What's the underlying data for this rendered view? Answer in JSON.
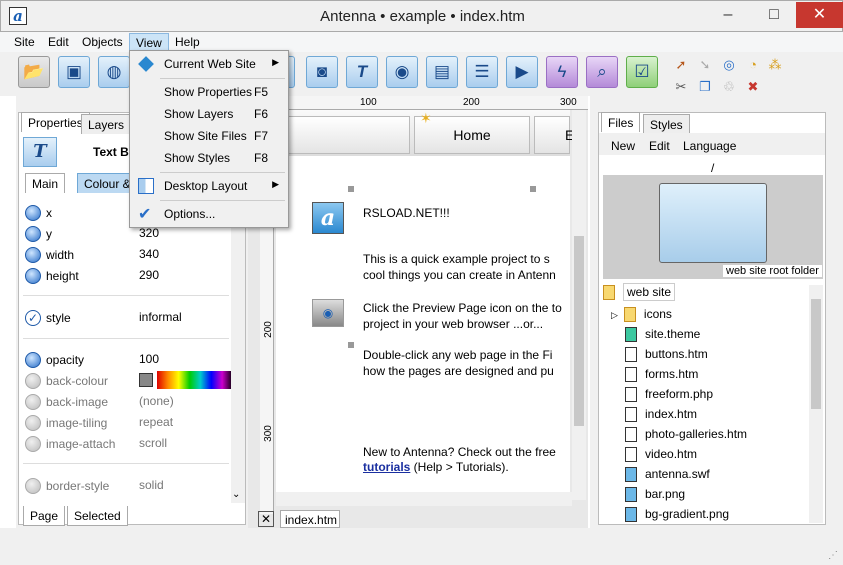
{
  "window": {
    "title": "Antenna • example • index.htm",
    "app_icon": "a",
    "minimize": "–",
    "maximize": "□",
    "close": "✕"
  },
  "menubar": [
    "Site",
    "Edit",
    "Objects",
    "View",
    "Help"
  ],
  "view_menu": {
    "current_web_site": "Current Web Site",
    "show_properties": "Show Properties",
    "show_properties_key": "F5",
    "show_layers": "Show Layers",
    "show_layers_key": "F6",
    "show_site_files": "Show Site Files",
    "show_site_files_key": "F7",
    "show_styles": "Show Styles",
    "show_styles_key": "F8",
    "desktop_layout": "Desktop Layout",
    "options": "Options..."
  },
  "left_panel": {
    "tabs": [
      "Properties",
      "Layers"
    ],
    "object_title": "Text B",
    "subtabs": [
      "Main",
      "Colour & S"
    ],
    "props": [
      {
        "name": "x",
        "value": ""
      },
      {
        "name": "y",
        "value": "320"
      },
      {
        "name": "width",
        "value": "340"
      },
      {
        "name": "height",
        "value": "290"
      },
      {
        "name": "style",
        "value": "informal"
      },
      {
        "name": "opacity",
        "value": "100"
      },
      {
        "name": "back-colour",
        "value": ""
      },
      {
        "name": "back-image",
        "value": "(none)"
      },
      {
        "name": "image-tiling",
        "value": "repeat"
      },
      {
        "name": "image-attach",
        "value": "scroll"
      },
      {
        "name": "border-style",
        "value": "solid"
      }
    ],
    "bottom_tabs": [
      "Page",
      "Selected"
    ]
  },
  "canvas": {
    "ruler_top": [
      "100",
      "200",
      "300"
    ],
    "ruler_left": [
      "200",
      "300"
    ],
    "nav_home": "Home",
    "nav_next": "E",
    "heading": "RSLOAD.NET!!!",
    "para1": "This is a quick example project to s",
    "para1b": "cool things you can create in Antenn",
    "para2": "Click the Preview Page icon on the to",
    "para2b": "project in your web browser ...or...",
    "para3": "Double-click any web page in the Fi",
    "para3b": "how the pages are designed and pu",
    "para4": "New to Antenna?  Check out the free",
    "link": "tutorials",
    "para4b": " (Help > Tutorials).",
    "doc_tab": "index.htm"
  },
  "right_panel": {
    "tabs": [
      "Files",
      "Styles"
    ],
    "toolbar": [
      "New",
      "Edit",
      "Language"
    ],
    "path": "/",
    "folder_caption": "web site root folder",
    "root": "web site",
    "files": [
      "icons",
      "site.theme",
      "buttons.htm",
      "forms.htm",
      "freeform.php",
      "index.htm",
      "photo-galleries.htm",
      "video.htm",
      "antenna.swf",
      "bar.png",
      "bg-gradient.png"
    ]
  }
}
